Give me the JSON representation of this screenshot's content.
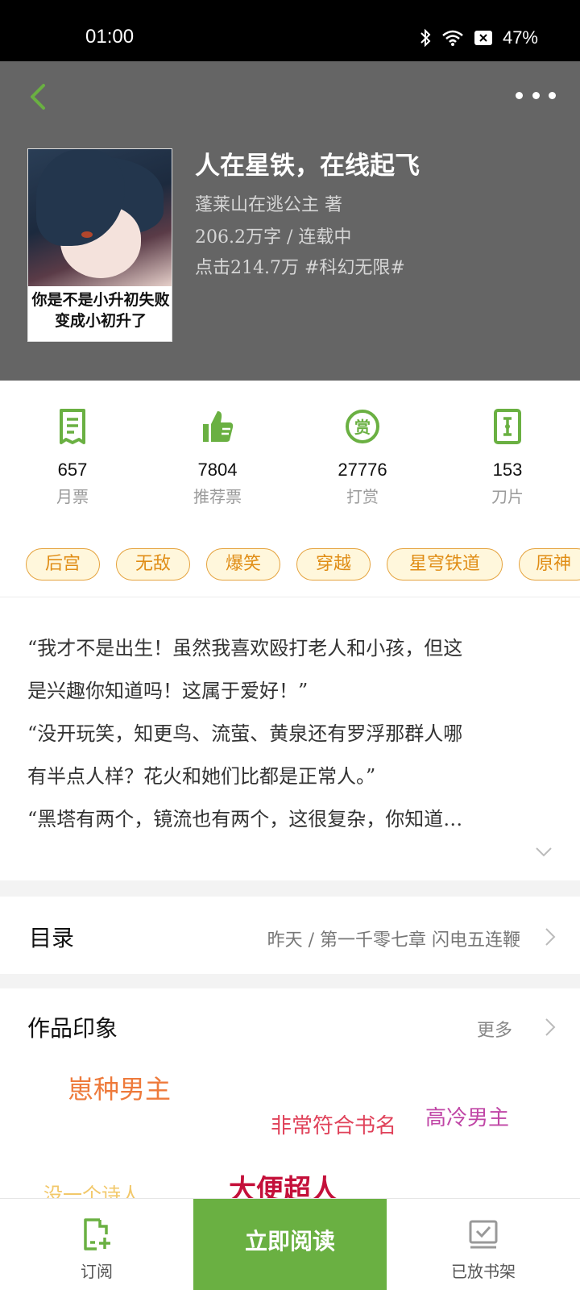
{
  "status_bar": {
    "time": "01:00",
    "battery": "47%"
  },
  "header": {
    "book_title": "人在星铁，在线起飞",
    "author_line": "蓬莱山在逃公主  著",
    "words_status": "206.2万字 / 连载中",
    "clicks_genre": "点击214.7万  #科幻无限#",
    "cover_caption_1": "你是不是小升初失败",
    "cover_caption_2": "变成小初升了"
  },
  "stats": [
    {
      "value": "657",
      "label": "月票",
      "icon": "ticket-icon"
    },
    {
      "value": "7804",
      "label": "推荐票",
      "icon": "thumbs-up-icon"
    },
    {
      "value": "27776",
      "label": "打赏",
      "icon": "reward-icon"
    },
    {
      "value": "153",
      "label": "刀片",
      "icon": "blade-icon"
    }
  ],
  "tags": [
    "后宫",
    "无敌",
    "爆笑",
    "穿越",
    "星穹铁道",
    "原神"
  ],
  "synopsis": [
    "“我才不是出生！虽然我喜欢殴打老人和小孩，但这",
    "是兴趣你知道吗！这属于爱好！”",
    "“没开玩笑，知更鸟、流萤、黄泉还有罗浮那群人哪",
    "有半点人样？花火和她们比都是正常人。”",
    "“黑塔有两个，镜流也有两个，这很复杂，你知道…"
  ],
  "toc": {
    "title": "目录",
    "latest": "昨天 / 第一千零七章 闪电五连鞭"
  },
  "impressions": {
    "title": "作品印象",
    "more": "更多",
    "words": [
      "崽种男主",
      "非常符合书名",
      "高冷男主",
      "没一个诗人",
      "大便超人"
    ]
  },
  "bottom_bar": {
    "subscribe": "订阅",
    "read_now": "立即阅读",
    "shelf": "已放书架"
  },
  "colors": {
    "accent": "#6ab042",
    "header_bg": "#656565",
    "tag_border": "#e5a23c"
  }
}
